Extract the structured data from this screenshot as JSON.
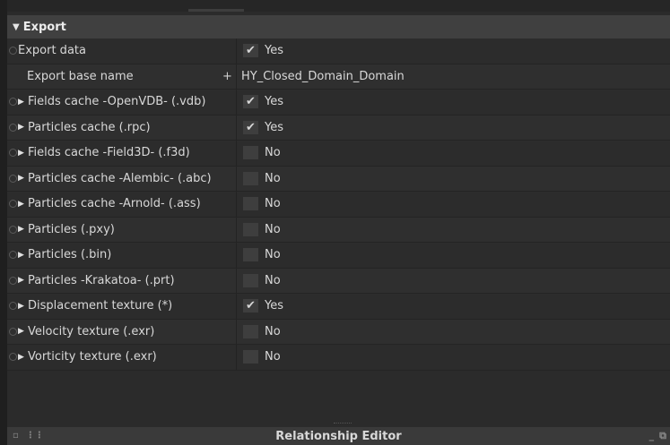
{
  "section": {
    "title": "Export"
  },
  "rows": [
    {
      "label": "Export data",
      "value": "Yes",
      "checked": true,
      "has_radio": true,
      "has_expand": false,
      "type": "checkbox"
    },
    {
      "label": "Export base name",
      "value": "HY_Closed_Domain_Domain",
      "plus": "+",
      "has_radio": false,
      "has_expand": false,
      "type": "text"
    },
    {
      "label": "Fields cache -OpenVDB- (.vdb)",
      "value": "Yes",
      "checked": true,
      "has_radio": true,
      "has_expand": true,
      "type": "checkbox"
    },
    {
      "label": "Particles cache (.rpc)",
      "value": "Yes",
      "checked": true,
      "has_radio": true,
      "has_expand": true,
      "type": "checkbox"
    },
    {
      "label": "Fields cache -Field3D- (.f3d)",
      "value": "No",
      "checked": false,
      "has_radio": true,
      "has_expand": true,
      "type": "checkbox"
    },
    {
      "label": "Particles cache -Alembic- (.abc)",
      "value": "No",
      "checked": false,
      "has_radio": true,
      "has_expand": true,
      "type": "checkbox"
    },
    {
      "label": "Particles cache -Arnold- (.ass)",
      "value": "No",
      "checked": false,
      "has_radio": true,
      "has_expand": true,
      "type": "checkbox"
    },
    {
      "label": "Particles (.pxy)",
      "value": "No",
      "checked": false,
      "has_radio": true,
      "has_expand": true,
      "type": "checkbox"
    },
    {
      "label": "Particles (.bin)",
      "value": "No",
      "checked": false,
      "has_radio": true,
      "has_expand": true,
      "type": "checkbox"
    },
    {
      "label": "Particles -Krakatoa- (.prt)",
      "value": "No",
      "checked": false,
      "has_radio": true,
      "has_expand": true,
      "type": "checkbox"
    },
    {
      "label": "Displacement texture (*)",
      "value": "Yes",
      "checked": true,
      "has_radio": true,
      "has_expand": true,
      "type": "checkbox"
    },
    {
      "label": "Velocity texture (.exr)",
      "value": "No",
      "checked": false,
      "has_radio": true,
      "has_expand": true,
      "type": "checkbox"
    },
    {
      "label": "Vorticity texture (.exr)",
      "value": "No",
      "checked": false,
      "has_radio": true,
      "has_expand": true,
      "type": "checkbox"
    }
  ],
  "bottom_bar": {
    "title": "Relationship Editor"
  },
  "icons": {
    "section_arrow": "triangle-down-icon",
    "row_expand": "triangle-right-icon",
    "check": "check-icon"
  },
  "colors": {
    "background": "#2b2b2b",
    "header": "#404040",
    "checkbox": "#3e3e3e",
    "text": "#d8d8d8"
  }
}
